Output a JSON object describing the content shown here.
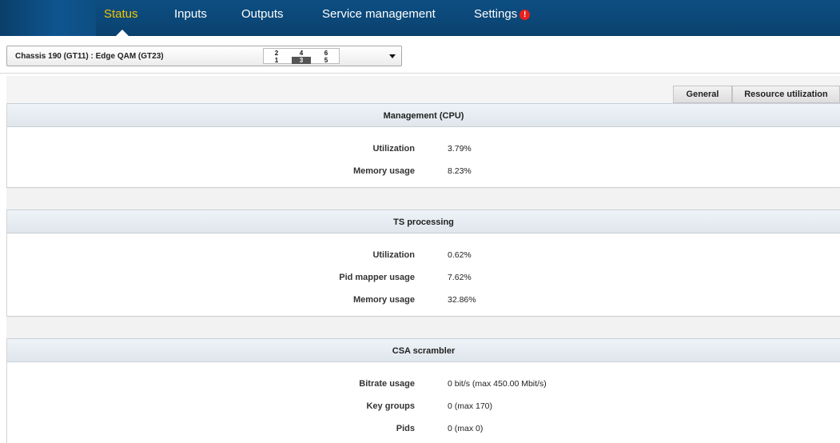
{
  "nav": {
    "items": [
      {
        "label": "Status",
        "active": true
      },
      {
        "label": "Inputs",
        "active": false
      },
      {
        "label": "Outputs",
        "active": false
      },
      {
        "label": "Service management",
        "active": false
      },
      {
        "label": "Settings",
        "active": false,
        "alert": "!"
      }
    ],
    "active_color": "#f5c400",
    "bar_color": "#0d4e82"
  },
  "chassis": {
    "selected_label": "Chassis 190 (GT11) : Edge QAM (GT23)",
    "slots": {
      "top": [
        "2",
        "4",
        "6"
      ],
      "bottom": [
        "1",
        "3",
        "5"
      ],
      "selected": "3"
    }
  },
  "tabs": [
    {
      "label": "General"
    },
    {
      "label": "Resource utilization"
    }
  ],
  "panels": [
    {
      "title": "Management (CPU)",
      "rows": [
        {
          "label": "Utilization",
          "value": "3.79%"
        },
        {
          "label": "Memory usage",
          "value": "8.23%"
        }
      ]
    },
    {
      "title": "TS processing",
      "rows": [
        {
          "label": "Utilization",
          "value": "0.62%"
        },
        {
          "label": "Pid mapper usage",
          "value": "7.62%"
        },
        {
          "label": "Memory usage",
          "value": "32.86%"
        }
      ]
    },
    {
      "title": "CSA scrambler",
      "rows": [
        {
          "label": "Bitrate usage",
          "value": "0 bit/s (max 450.00 Mbit/s)"
        },
        {
          "label": "Key groups",
          "value": "0 (max 170)"
        },
        {
          "label": "Pids",
          "value": "0 (max 0)"
        }
      ]
    }
  ]
}
